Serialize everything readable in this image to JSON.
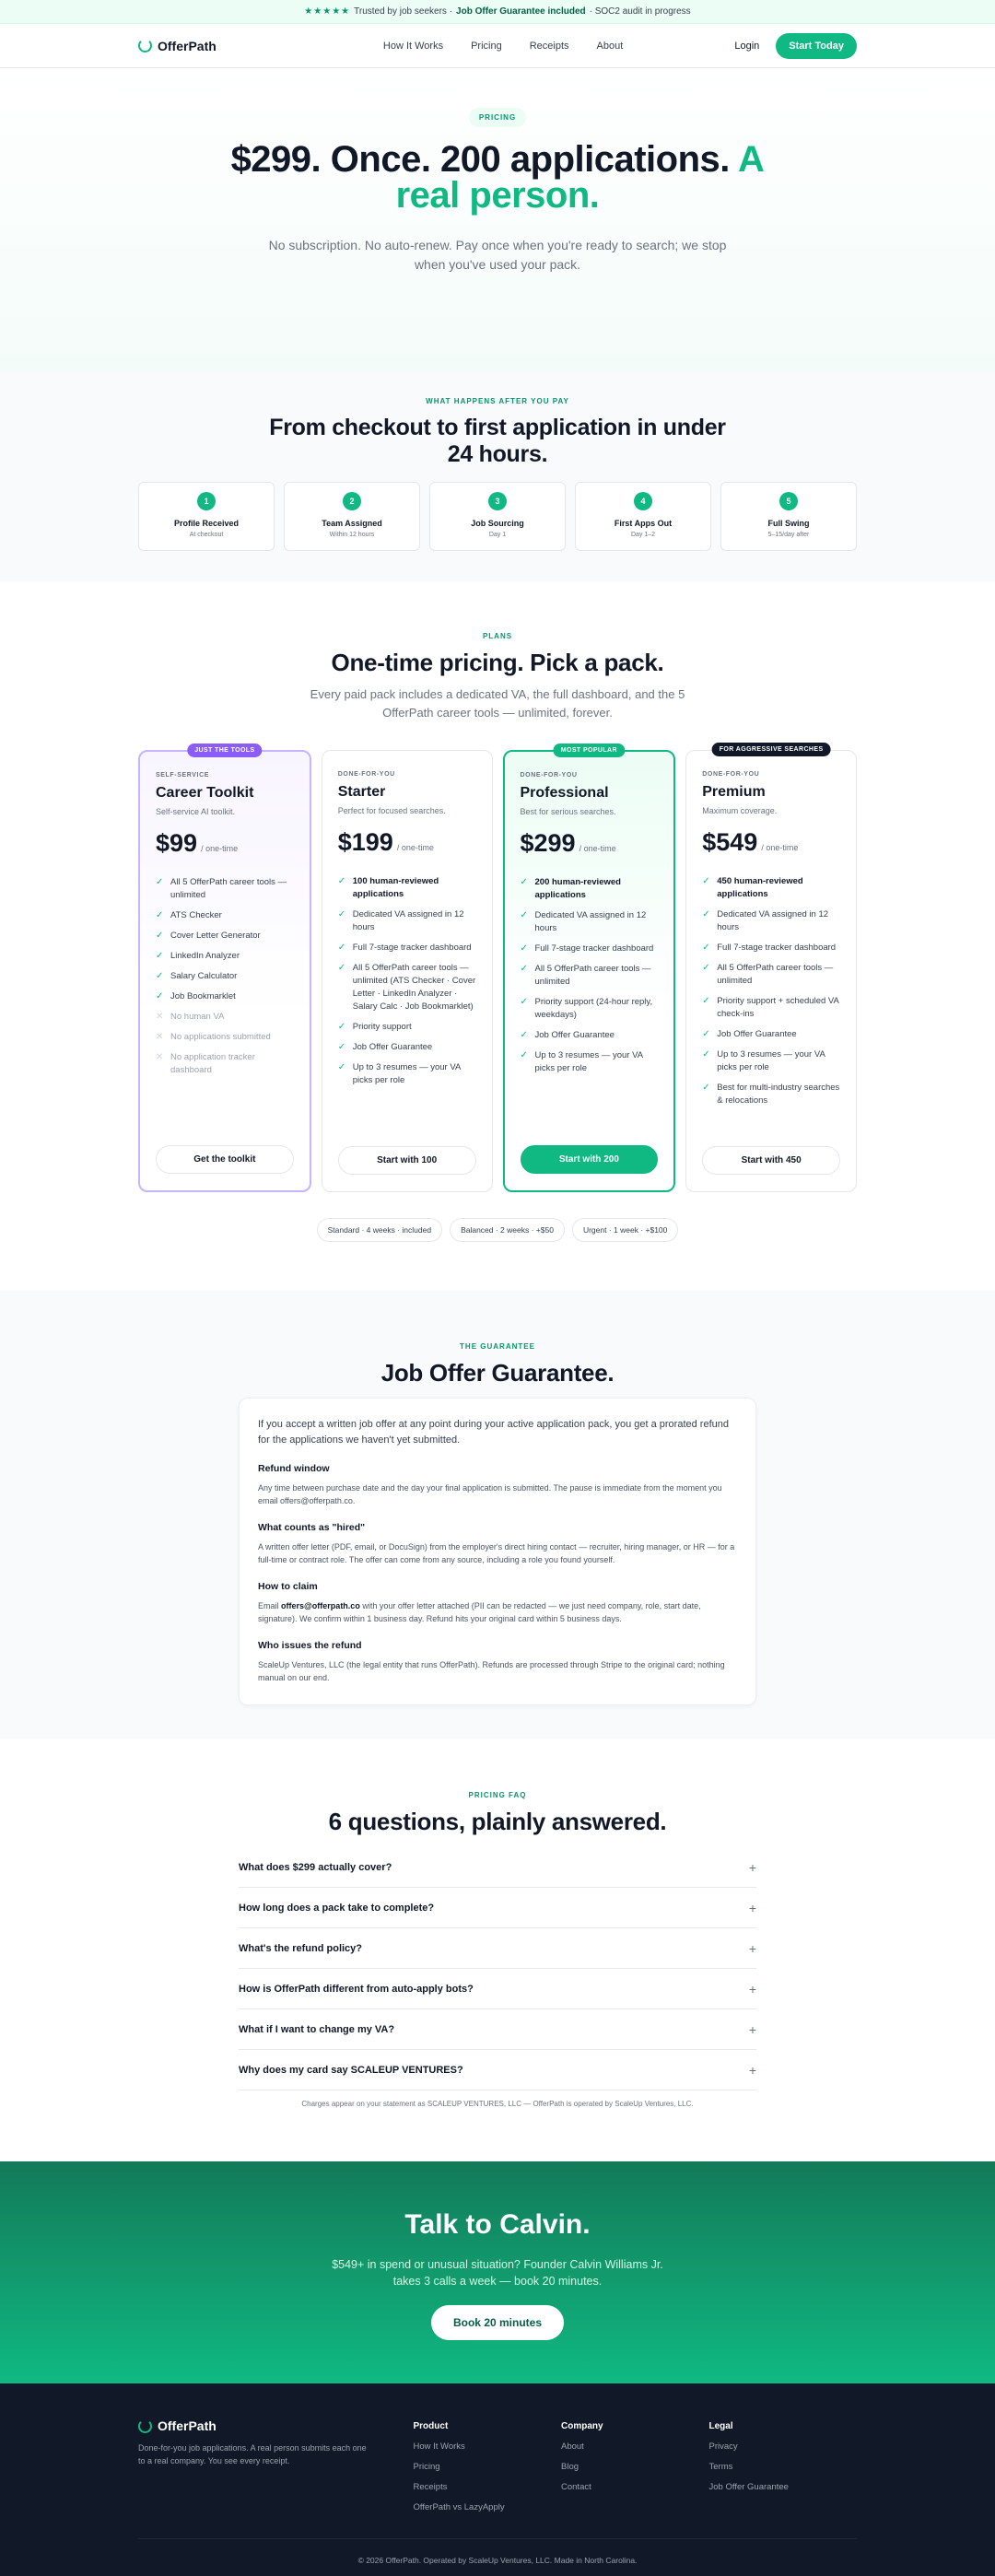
{
  "banner": {
    "stars": "★★★★★",
    "prefix": "Trusted by job seekers ·",
    "highlight": "Job Offer Guarantee included",
    "suffix": "· SOC2 audit in progress"
  },
  "nav": {
    "brand": "OfferPath",
    "links": [
      "How It Works",
      "Pricing",
      "Receipts",
      "About"
    ],
    "login": "Login",
    "cta": "Start Today"
  },
  "hero": {
    "label": "PRICING",
    "title": "$299. Once. 200 applications.",
    "title_accent": "A real person.",
    "subtitle": "No subscription. No auto-renew. Pay once when you're ready to search; we stop when you've used your pack."
  },
  "timeline": {
    "eyebrow": "WHAT HAPPENS AFTER YOU PAY",
    "title": "From checkout to first application in under 24 hours.",
    "steps": [
      {
        "num": "1",
        "title": "Profile Received",
        "sub": "At checkout"
      },
      {
        "num": "2",
        "title": "Team Assigned",
        "sub": "Within 12 hours"
      },
      {
        "num": "3",
        "title": "Job Sourcing",
        "sub": "Day 1"
      },
      {
        "num": "4",
        "title": "First Apps Out",
        "sub": "Day 1–2"
      },
      {
        "num": "5",
        "title": "Full Swing",
        "sub": "5–15/day after"
      }
    ]
  },
  "plans": {
    "eyebrow": "PLANS",
    "title": "One-time pricing. Pick a pack.",
    "subtitle": "Every paid pack includes a dedicated VA, the full dashboard, and the 5 OfferPath career tools — unlimited, forever.",
    "cards": [
      {
        "badge": "JUST THE TOOLS",
        "badge_color": "#8b5cf6",
        "eyebrow": "SELF-SERVICE",
        "name": "Career Toolkit",
        "desc": "Self-service AI toolkit.",
        "price": "$99",
        "per": "/ one-time",
        "features": [
          {
            "text": "All 5 OfferPath career tools — unlimited",
            "state": "on"
          },
          {
            "text": "ATS Checker",
            "state": "on"
          },
          {
            "text": "Cover Letter Generator",
            "state": "on"
          },
          {
            "text": "LinkedIn Analyzer",
            "state": "on"
          },
          {
            "text": "Salary Calculator",
            "state": "on"
          },
          {
            "text": "Job Bookmarklet",
            "state": "on"
          },
          {
            "text": "No human VA",
            "state": "off"
          },
          {
            "text": "No applications submitted",
            "state": "off"
          },
          {
            "text": "No application tracker dashboard",
            "state": "off"
          }
        ],
        "button": "Get the toolkit"
      },
      {
        "badge": "",
        "badge_color": "",
        "eyebrow": "DONE-FOR-YOU",
        "name": "Starter",
        "desc": "Perfect for focused searches.",
        "price": "$199",
        "per": "/ one-time",
        "features": [
          {
            "text": "100 human-reviewed applications",
            "state": "strong"
          },
          {
            "text": "Dedicated VA assigned in 12 hours",
            "state": "on"
          },
          {
            "text": "Full 7-stage tracker dashboard",
            "state": "on"
          },
          {
            "text": "All 5 OfferPath career tools — unlimited (ATS Checker · Cover Letter · LinkedIn Analyzer · Salary Calc · Job Bookmarklet)",
            "state": "on"
          },
          {
            "text": "Priority support",
            "state": "on"
          },
          {
            "text": "Job Offer Guarantee",
            "state": "on"
          },
          {
            "text": "Up to 3 resumes — your VA picks per role",
            "state": "on"
          }
        ],
        "button": "Start with 100"
      },
      {
        "badge": "MOST POPULAR",
        "badge_color": "#10b981",
        "eyebrow": "DONE-FOR-YOU",
        "name": "Professional",
        "desc": "Best for serious searches.",
        "price": "$299",
        "per": "/ one-time",
        "features": [
          {
            "text": "200 human-reviewed applications",
            "state": "strong"
          },
          {
            "text": "Dedicated VA assigned in 12 hours",
            "state": "on"
          },
          {
            "text": "Full 7-stage tracker dashboard",
            "state": "on"
          },
          {
            "text": "All 5 OfferPath career tools — unlimited",
            "state": "on"
          },
          {
            "text": "Priority support (24-hour reply, weekdays)",
            "state": "on"
          },
          {
            "text": "Job Offer Guarantee",
            "state": "on"
          },
          {
            "text": "Up to 3 resumes — your VA picks per role",
            "state": "on"
          }
        ],
        "button": "Start with 200"
      },
      {
        "badge": "FOR AGGRESSIVE SEARCHES",
        "badge_color": "#111827",
        "eyebrow": "DONE-FOR-YOU",
        "name": "Premium",
        "desc": "Maximum coverage.",
        "price": "$549",
        "per": "/ one-time",
        "features": [
          {
            "text": "450 human-reviewed applications",
            "state": "strong"
          },
          {
            "text": "Dedicated VA assigned in 12 hours",
            "state": "on"
          },
          {
            "text": "Full 7-stage tracker dashboard",
            "state": "on"
          },
          {
            "text": "All 5 OfferPath career tools — unlimited",
            "state": "on"
          },
          {
            "text": "Priority support + scheduled VA check-ins",
            "state": "on"
          },
          {
            "text": "Job Offer Guarantee",
            "state": "on"
          },
          {
            "text": "Up to 3 resumes — your VA picks per role",
            "state": "on"
          },
          {
            "text": "Best for multi-industry searches & relocations",
            "state": "on"
          }
        ],
        "button": "Start with 450"
      }
    ],
    "speeds": [
      "Standard · 4 weeks · included",
      "Balanced · 2 weeks · +$50",
      "Urgent · 1 week · +$100"
    ]
  },
  "guarantee": {
    "eyebrow": "THE GUARANTEE",
    "title": "Job Offer Guarantee.",
    "intro": "If you accept a written job offer at any point during your active application pack, you get a prorated refund for the applications we haven't yet submitted.",
    "refund_h": "Refund window",
    "refund_p": "Any time between purchase date and the day your final application is submitted. The pause is immediate from the moment you email offers@offerpath.co.",
    "counts_h": "What counts as \"hired\"",
    "counts_p": "A written offer letter (PDF, email, or DocuSign) from the employer's direct hiring contact — recruiter, hiring manager, or HR — for a full-time or contract role. The offer can come from any source, including a role you found yourself.",
    "claim_h": "How to claim",
    "claim_pre": "Email",
    "claim_email": "offers@offerpath.co",
    "claim_post": "with your offer letter attached (PII can be redacted — we just need company, role, start date, signature). We confirm within 1 business day. Refund hits your original card within 5 business days.",
    "who_h": "Who issues the refund",
    "who_p": "ScaleUp Ventures, LLC (the legal entity that runs OfferPath). Refunds are processed through Stripe to the original card; nothing manual on our end."
  },
  "faq": {
    "eyebrow": "PRICING FAQ",
    "title": "6 questions, plainly answered.",
    "items": [
      "What does $299 actually cover?",
      "How long does a pack take to complete?",
      "What's the refund policy?",
      "How is OfferPath different from auto-apply bots?",
      "What if I want to change my VA?",
      "Why does my card say SCALEUP VENTURES?"
    ],
    "plus": "+",
    "note": "Charges appear on your statement as SCALEUP VENTURES, LLC — OfferPath is operated by ScaleUp Ventures, LLC."
  },
  "cta": {
    "title": "Talk to Calvin.",
    "subtitle": "$549+ in spend or unusual situation? Founder Calvin Williams Jr. takes 3 calls a week — book 20 minutes.",
    "button": "Book 20 minutes"
  },
  "footer": {
    "brand": "OfferPath",
    "tagline": "Done-for-you job applications. A real person submits each one to a real company. You see every receipt.",
    "product_h": "Product",
    "product_links": [
      "How It Works",
      "Pricing",
      "Receipts",
      "OfferPath vs LazyApply"
    ],
    "company_h": "Company",
    "company_links": [
      "About",
      "Blog",
      "Contact"
    ],
    "legal_h": "Legal",
    "legal_links": [
      "Privacy",
      "Terms",
      "Job Offer Guarantee"
    ],
    "copyright": "© 2026 OfferPath. Operated by ScaleUp Ventures, LLC. Made in North Carolina."
  }
}
